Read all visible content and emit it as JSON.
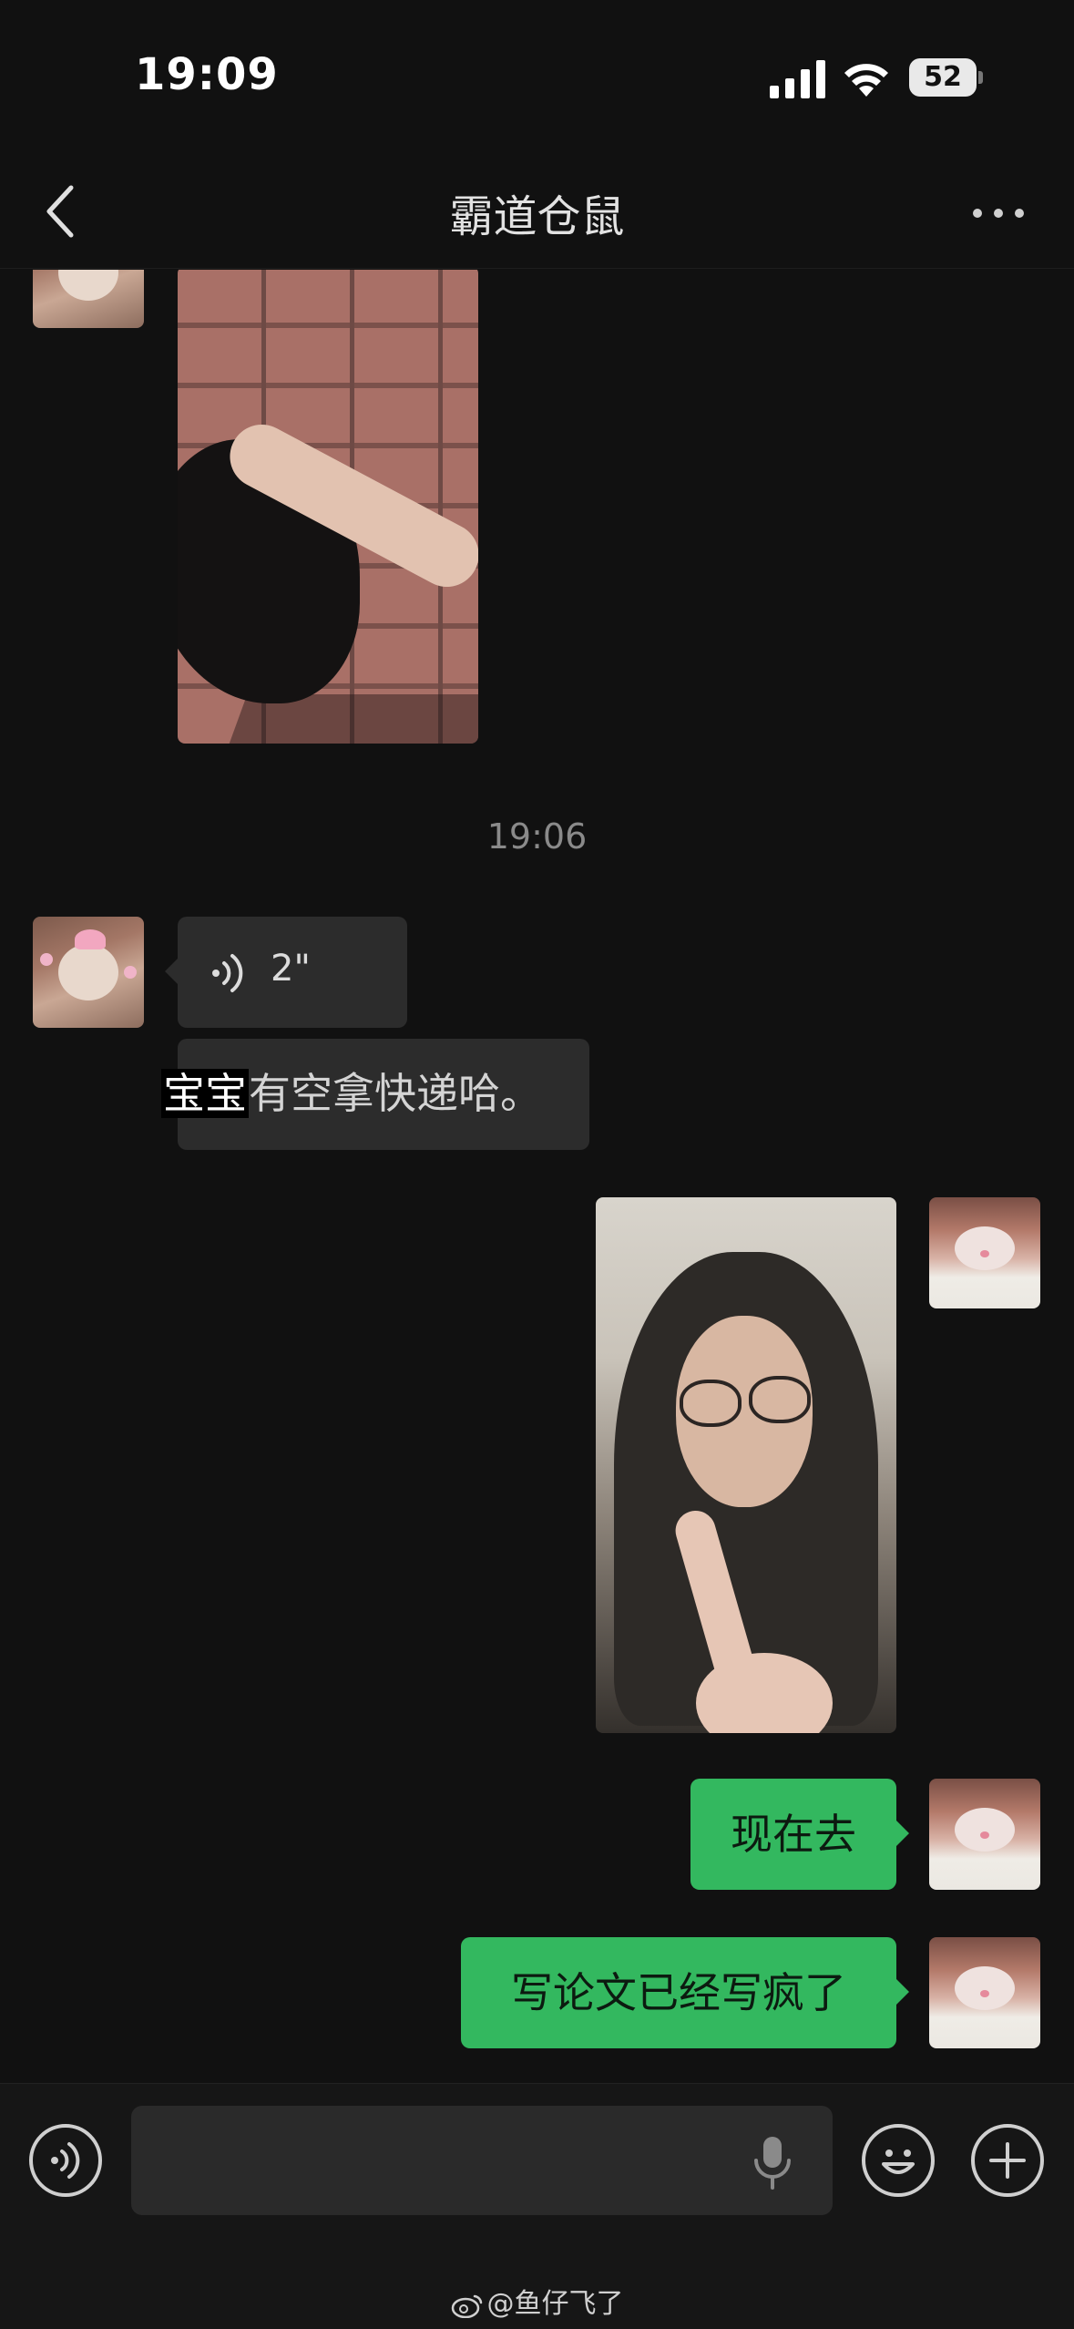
{
  "status_bar": {
    "time": "19:09",
    "battery": "52"
  },
  "header": {
    "title": "霸道仓鼠"
  },
  "messages": {
    "timestamp": "19:06",
    "voice_duration": "2\"",
    "incoming_text_highlight": "宝宝",
    "incoming_text_rest": "有空拿快递哈。",
    "outgoing_1": "现在去",
    "outgoing_2": "写论文已经写疯了"
  },
  "input_bar": {
    "placeholder": ""
  },
  "watermark": {
    "text": "@鱼仔飞了"
  },
  "icons": {
    "back": "chevron-left-icon",
    "more": "more-dots-icon",
    "voice_toggle": "voice-icon",
    "mic": "microphone-icon",
    "emoji": "emoji-icon",
    "add": "plus-icon"
  },
  "colors": {
    "background": "#111111",
    "outgoing_bubble": "#33b85f",
    "incoming_bubble": "#2c2c2c"
  }
}
